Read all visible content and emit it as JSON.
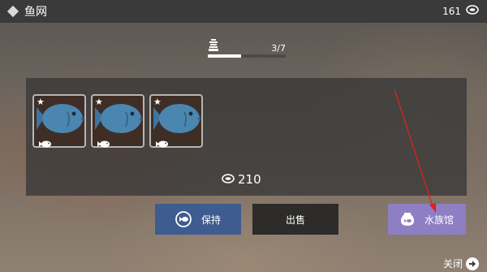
{
  "header": {
    "title": "鱼网",
    "coins": "161",
    "coin_icon": "coin-icon"
  },
  "net": {
    "count": "3/7",
    "progress_fraction": 0.4286,
    "icon": "bucket-icon"
  },
  "catch": {
    "slots": [
      {
        "star": "★",
        "fish_icon": "blue-fish-icon",
        "mini_icon": "mini-fish-icon"
      },
      {
        "star": "★",
        "fish_icon": "blue-fish-icon",
        "mini_icon": "mini-fish-icon"
      },
      {
        "star": "★",
        "fish_icon": "blue-fish-icon",
        "mini_icon": "mini-fish-icon"
      }
    ],
    "total_value": "210"
  },
  "buttons": {
    "keep_label": "保持",
    "sell_label": "出售",
    "aquarium_label": "水族馆",
    "close_label": "关闭"
  },
  "colors": {
    "keep_button": "#3e5c8f",
    "sell_button": "#2e2c2a",
    "aquarium_button": "#8e7fc4",
    "fish": "#4a86b0",
    "annotation_arrow": "#e02020"
  }
}
